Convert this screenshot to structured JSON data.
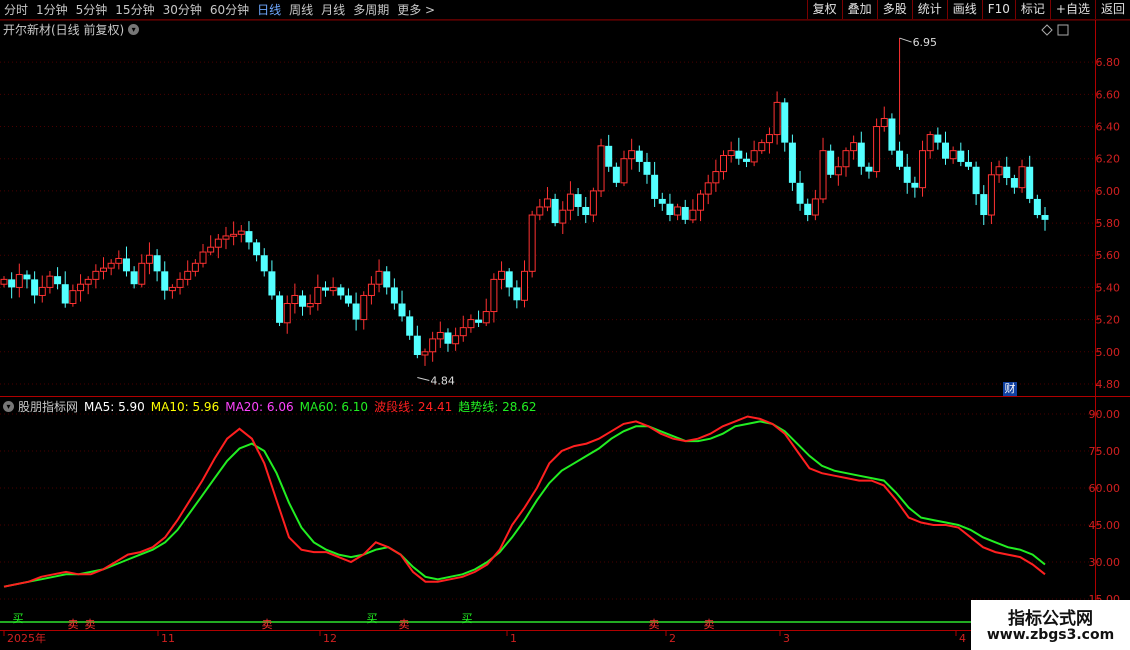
{
  "toolbar": {
    "periods": [
      "分时",
      "1分钟",
      "5分钟",
      "15分钟",
      "30分钟",
      "60分钟",
      "日线",
      "周线",
      "月线",
      "多周期",
      "更多 >"
    ],
    "active_period": "日线",
    "right_buttons": [
      "复权",
      "叠加",
      "多股",
      "统计",
      "画线",
      "F10",
      "标记",
      "+自选",
      "返回"
    ]
  },
  "main_chart": {
    "title": "开尔新材(日线 前复权)",
    "price_ticks": [
      "6.80",
      "6.60",
      "6.40",
      "6.20",
      "6.00",
      "5.80",
      "5.60",
      "5.40",
      "5.20",
      "5.00",
      "4.80"
    ],
    "high_label": "6.95",
    "low_label": "4.84",
    "cai_badge": "财"
  },
  "indicator": {
    "name": "股朋指标网",
    "ma5": "MA5: 5.90",
    "ma10": "MA10: 5.96",
    "ma20": "MA20: 6.06",
    "ma60": "MA60: 6.10",
    "wave": "波段线: 24.41",
    "trend": "趋势线: 28.62",
    "ticks": [
      "90.00",
      "75.00",
      "60.00",
      "45.00",
      "30.00",
      "15.00"
    ],
    "signals": [
      "买",
      "卖",
      "卖",
      "卖",
      "买",
      "卖",
      "买",
      "卖",
      "卖"
    ]
  },
  "x_axis": {
    "labels": [
      "2025年",
      "11",
      "12",
      "1",
      "2",
      "3",
      "4"
    ]
  },
  "watermark": {
    "line1": "指标公式网",
    "line2": "www.zbgs3.com"
  },
  "colors": {
    "up": "#ff3232",
    "down": "#54ffff",
    "wave": "#ff2020",
    "trend": "#22ee22",
    "ma5": "#ffffff",
    "ma10": "#ffff00",
    "ma20": "#ff44ff",
    "ma60": "#22ee22"
  },
  "chart_data": [
    {
      "type": "candlestick",
      "title": "开尔新材(日线 前复权)",
      "y_range": [
        4.75,
        7.0
      ],
      "high": 6.95,
      "low": 4.84,
      "closes": [
        5.45,
        5.4,
        5.48,
        5.45,
        5.35,
        5.4,
        5.47,
        5.42,
        5.3,
        5.38,
        5.42,
        5.45,
        5.5,
        5.52,
        5.55,
        5.58,
        5.5,
        5.42,
        5.55,
        5.6,
        5.5,
        5.38,
        5.4,
        5.45,
        5.5,
        5.55,
        5.62,
        5.65,
        5.7,
        5.72,
        5.73,
        5.75,
        5.68,
        5.6,
        5.5,
        5.35,
        5.18,
        5.3,
        5.35,
        5.28,
        5.3,
        5.4,
        5.38,
        5.4,
        5.35,
        5.3,
        5.2,
        5.35,
        5.42,
        5.5,
        5.4,
        5.3,
        5.22,
        5.1,
        4.98,
        5.0,
        5.08,
        5.12,
        5.05,
        5.1,
        5.15,
        5.2,
        5.18,
        5.25,
        5.45,
        5.5,
        5.4,
        5.32,
        5.5,
        5.85,
        5.9,
        5.95,
        5.8,
        5.88,
        5.98,
        5.9,
        5.85,
        6.0,
        6.28,
        6.15,
        6.05,
        6.2,
        6.25,
        6.18,
        6.1,
        5.95,
        5.92,
        5.85,
        5.9,
        5.82,
        5.88,
        5.98,
        6.05,
        6.12,
        6.22,
        6.25,
        6.2,
        6.18,
        6.25,
        6.3,
        6.35,
        6.55,
        6.3,
        6.05,
        5.92,
        5.85,
        5.95,
        6.25,
        6.1,
        6.15,
        6.25,
        6.3,
        6.15,
        6.12,
        6.4,
        6.45,
        6.25,
        6.15,
        6.05,
        6.02,
        6.25,
        6.35,
        6.3,
        6.2,
        6.25,
        6.18,
        6.15,
        5.98,
        5.85,
        6.1,
        6.15,
        6.08,
        6.02,
        6.15,
        5.95,
        5.85,
        5.82
      ]
    },
    {
      "type": "line",
      "title": "股朋指标网",
      "y_range": [
        15,
        90
      ],
      "series": [
        {
          "name": "波段线",
          "values": [
            20,
            21,
            22,
            24,
            25,
            26,
            25,
            25,
            27,
            30,
            33,
            34,
            36,
            40,
            47,
            55,
            63,
            72,
            80,
            84,
            80,
            70,
            55,
            40,
            35,
            34,
            34,
            32,
            30,
            33,
            38,
            36,
            33,
            26,
            22,
            22,
            23,
            24,
            26,
            29,
            35,
            45,
            52,
            60,
            70,
            75,
            77,
            78,
            80,
            83,
            86,
            87,
            85,
            82,
            80,
            79,
            80,
            82,
            85,
            87,
            89,
            88,
            86,
            82,
            75,
            68,
            66,
            65,
            64,
            63,
            63,
            61,
            55,
            48,
            46,
            45,
            45,
            44,
            40,
            36,
            34,
            33,
            32,
            29,
            25
          ]
        },
        {
          "name": "趋势线",
          "values": [
            20,
            21,
            22,
            23,
            24,
            25,
            25,
            26,
            27,
            29,
            31,
            33,
            35,
            38,
            43,
            50,
            57,
            64,
            71,
            76,
            78,
            75,
            66,
            54,
            44,
            38,
            35,
            33,
            32,
            33,
            35,
            36,
            33,
            28,
            24,
            23,
            24,
            25,
            27,
            30,
            34,
            40,
            47,
            55,
            62,
            67,
            70,
            73,
            76,
            80,
            83,
            85,
            85,
            83,
            81,
            79,
            79,
            80,
            82,
            85,
            86,
            87,
            86,
            83,
            78,
            73,
            69,
            67,
            66,
            65,
            64,
            63,
            58,
            52,
            48,
            47,
            46,
            45,
            43,
            40,
            38,
            36,
            35,
            33,
            29
          ]
        }
      ]
    }
  ]
}
